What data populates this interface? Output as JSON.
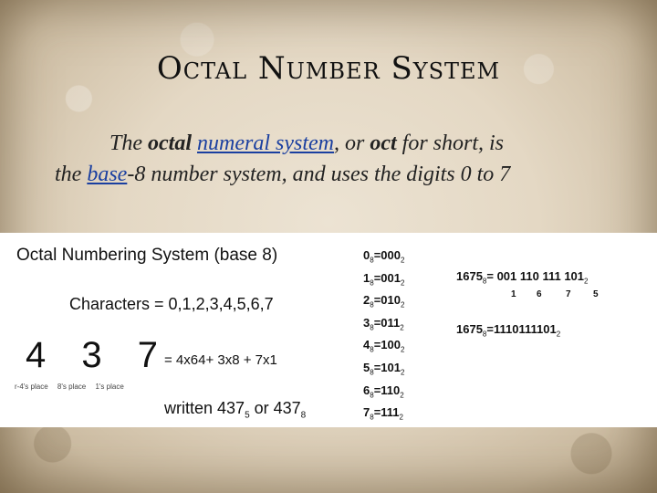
{
  "slide": {
    "title": "Octal Number System",
    "intro": {
      "line1_pre": "The ",
      "octal_bold": "octal",
      "space": " ",
      "link1": "numeral system",
      "mid": ", or ",
      "oct_bold": "oct",
      "line1_post": " for short, is",
      "line2_pre": "the ",
      "link2": "base",
      "line2_post": "-8 number system, and uses the digits 0 to 7"
    }
  },
  "panel": {
    "title": "Octal Numbering System (base 8)",
    "characters": "Characters = 0,1,2,3,4,5,6,7",
    "digits": "4 3 7",
    "places": [
      "r-4's place",
      "8's place",
      "1's place"
    ],
    "expansion": "=  4x64+ 3x8 + 7x1",
    "written_a": "written 437",
    "written_a_sub": "5",
    "written_b": "  or 437",
    "written_b_sub": "8",
    "conversions": [
      {
        "d": "0",
        "b": "000"
      },
      {
        "d": "1",
        "b": "001"
      },
      {
        "d": "2",
        "b": "010"
      },
      {
        "d": "3",
        "b": "011"
      },
      {
        "d": "4",
        "b": "100"
      },
      {
        "d": "5",
        "b": "101"
      },
      {
        "d": "6",
        "b": "110"
      },
      {
        "d": "7",
        "b": "111"
      }
    ],
    "sub8": "8",
    "sub2": "2",
    "bin_example": "1675",
    "bin_grouped": "= 001 110 111 101",
    "groups": [
      "1",
      "6",
      "7",
      "5"
    ],
    "bin_full": "=1110111101"
  }
}
